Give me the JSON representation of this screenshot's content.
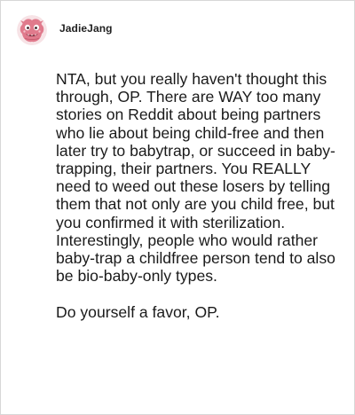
{
  "post": {
    "username": "JadieJang",
    "avatar_icon": "pink-cartoon-creature-avatar",
    "paragraphs": [
      "NTA, but you really haven't thought this through, OP. There are WAY too many stories on Reddit about being partners who lie about being child-free and then later try to babytrap, or succeed in baby-trapping, their partners. You REALLY need to weed out these losers by telling them that not only are you child free, but you confirmed it with sterilization. Interestingly, people who would rather baby-trap a childfree person tend to also be bio-baby-only types.",
      "Do yourself a favor, OP."
    ]
  },
  "colors": {
    "avatar_pink": "#e07a8c",
    "avatar_light": "#f3c1c9",
    "text": "#1a1a1a",
    "border": "#d7d7d7"
  }
}
